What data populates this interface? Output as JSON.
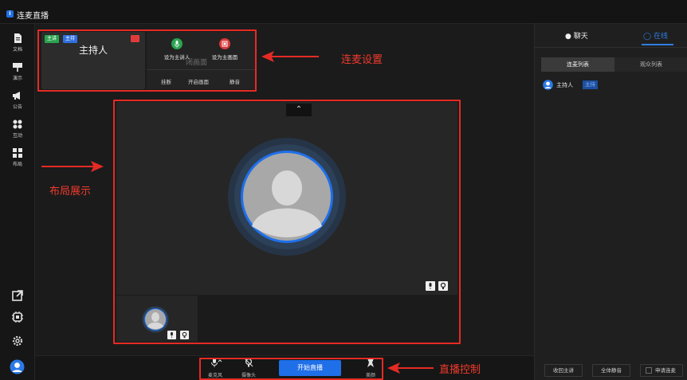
{
  "app": {
    "title": "连麦直播"
  },
  "sidebar": {
    "items": [
      {
        "label": "文档",
        "icon": "document-icon"
      },
      {
        "label": "演示",
        "icon": "presentation-icon"
      },
      {
        "label": "公告",
        "icon": "megaphone-icon"
      },
      {
        "label": "互动",
        "icon": "interaction-icon"
      },
      {
        "label": "布局",
        "icon": "layout-icon"
      }
    ],
    "bottom_icons": [
      "external-link-icon",
      "chip-icon",
      "gear-icon",
      "user-avatar-icon"
    ]
  },
  "host_card": {
    "tags": [
      "主讲",
      "主持"
    ],
    "name": "主持人"
  },
  "mic_menu": {
    "set_speaker": "设为主讲人",
    "set_main": "设为主画面",
    "ghost_text": "闭画面",
    "hangup": "挂断",
    "open_screen": "开启画面",
    "mute": "静音"
  },
  "annotations": {
    "mic_settings": "连麦设置",
    "layout_display": "布局展示",
    "live_control": "直播控制"
  },
  "bottom_bar": {
    "mic": "麦克风",
    "camera": "摄像头",
    "start_live": "开始直播",
    "beauty": "美颜"
  },
  "right_panel": {
    "tabs": {
      "chat": "聊天",
      "online": "在线"
    },
    "subtabs": {
      "mic_list": "连麦列表",
      "audience_list": "观众列表"
    },
    "member": {
      "name": "主持人",
      "role": "主持"
    },
    "footer": {
      "revoke": "收回主讲",
      "mute_all": "全体静音",
      "apply": "申请连麦"
    }
  },
  "colors": {
    "accent": "#1f6fe8",
    "annotation": "#e52b24",
    "speak_tag": "#2aa44f",
    "host_tag": "#2f6fe0"
  }
}
